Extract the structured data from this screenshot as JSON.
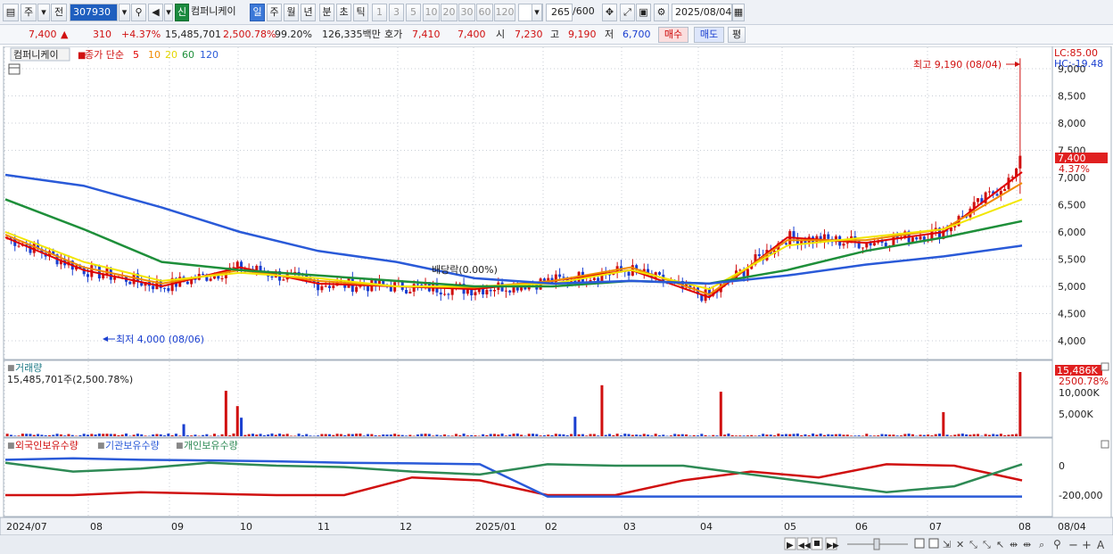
{
  "toolbar": {
    "type_label": "주",
    "market_label": "전",
    "stock_code": "307930",
    "new_badge": "신",
    "stock_name": "컴퍼니케이",
    "periods": [
      "일",
      "주",
      "월",
      "년",
      "분",
      "초",
      "틱"
    ],
    "active_period": "일",
    "minutes": [
      "1",
      "3",
      "5",
      "10",
      "20",
      "30",
      "60",
      "120"
    ],
    "count_value": "265",
    "count_max": "/600",
    "date_value": "2025/08/04"
  },
  "quote": {
    "price": "7,400",
    "change": "310",
    "change_pct": "+4.37%",
    "volume": "15,485,701",
    "volume_ratio": "2,500.78%",
    "strength": "99.20%",
    "amount": "126,335백만",
    "bid_label": "호가",
    "bid1": "7,410",
    "bid2": "7,400",
    "open_label": "시",
    "open": "7,230",
    "high_label": "고",
    "high": "9,190",
    "low_label": "저",
    "low": "6,700",
    "buy_label": "매수",
    "sell_label": "매도",
    "avg_label": "평"
  },
  "price_pane": {
    "legend_name": "컴퍼니케이",
    "legend_ma_title": "종가 단순",
    "ma_periods": [
      "5",
      "10",
      "20",
      "60",
      "120"
    ],
    "lc_label": "LC:85.00",
    "hc_label": "HC:-19.48",
    "max_label": "최고 9,190 (08/04)",
    "min_label": "최저 4,000 (08/06)",
    "div_label": "배당락(0.00%)",
    "current_price": "7,400",
    "current_pct": "4.37%",
    "y_ticks": [
      "9,000",
      "8,500",
      "8,000",
      "7,500",
      "7,000",
      "6,500",
      "6,000",
      "5,500",
      "5,000",
      "4,500",
      "4,000"
    ]
  },
  "volume_pane": {
    "title": "거래량",
    "detail": "15,485,701주(2,500.78%)",
    "current_value": "15,486K",
    "current_pct": "2500.78%",
    "y_ticks": [
      "10,000K",
      "5,000K"
    ]
  },
  "holding_pane": {
    "legend": [
      "외국인보유수량",
      "기관보유수량",
      "개인보유수량"
    ],
    "y_ticks": [
      "0",
      "-200,000"
    ]
  },
  "x_axis": {
    "labels": [
      "2024/07",
      "08",
      "09",
      "10",
      "11",
      "12",
      "2025/01",
      "02",
      "03",
      "04",
      "05",
      "06",
      "07",
      "08"
    ],
    "right_label": "08/04"
  },
  "colors": {
    "up": "#d01010",
    "down": "#1a3fd0",
    "ma5": "#e00000",
    "ma10": "#f08a00",
    "ma20": "#f2e600",
    "ma60": "#1e8f3a",
    "ma120": "#2a5ad8",
    "foreign": "#d01010",
    "institution": "#2a5ad8",
    "individual": "#2e8a55"
  },
  "chart_data": {
    "type": "line",
    "x": [
      "2024/07",
      "2024/08",
      "2024/09",
      "2024/10",
      "2024/11",
      "2024/12",
      "2025/01",
      "2025/02",
      "2025/03",
      "2025/04",
      "2025/05",
      "2025/06",
      "2025/07",
      "2025/08"
    ],
    "series": [
      {
        "name": "5",
        "values": [
          5900,
          5300,
          5000,
          5350,
          5050,
          5000,
          4950,
          5100,
          5300,
          4800,
          5900,
          5800,
          6000,
          7100
        ]
      },
      {
        "name": "10",
        "values": [
          5950,
          5350,
          5050,
          5300,
          5100,
          5000,
          4980,
          5100,
          5350,
          4850,
          5850,
          5850,
          6050,
          6900
        ]
      },
      {
        "name": "20",
        "values": [
          6000,
          5450,
          5100,
          5250,
          5150,
          5000,
          5000,
          5050,
          5300,
          4950,
          5750,
          5900,
          6050,
          6600
        ]
      },
      {
        "name": "60",
        "values": [
          6600,
          6050,
          5450,
          5300,
          5200,
          5100,
          5000,
          5000,
          5100,
          5050,
          5300,
          5650,
          5900,
          6200
        ]
      },
      {
        "name": "120",
        "values": [
          7050,
          6850,
          6450,
          6000,
          5650,
          5450,
          5150,
          5050,
          5100,
          5050,
          5200,
          5400,
          5550,
          5750
        ]
      }
    ],
    "ylim": [
      3700,
      9200
    ],
    "grid": true,
    "legend": "top-left"
  }
}
